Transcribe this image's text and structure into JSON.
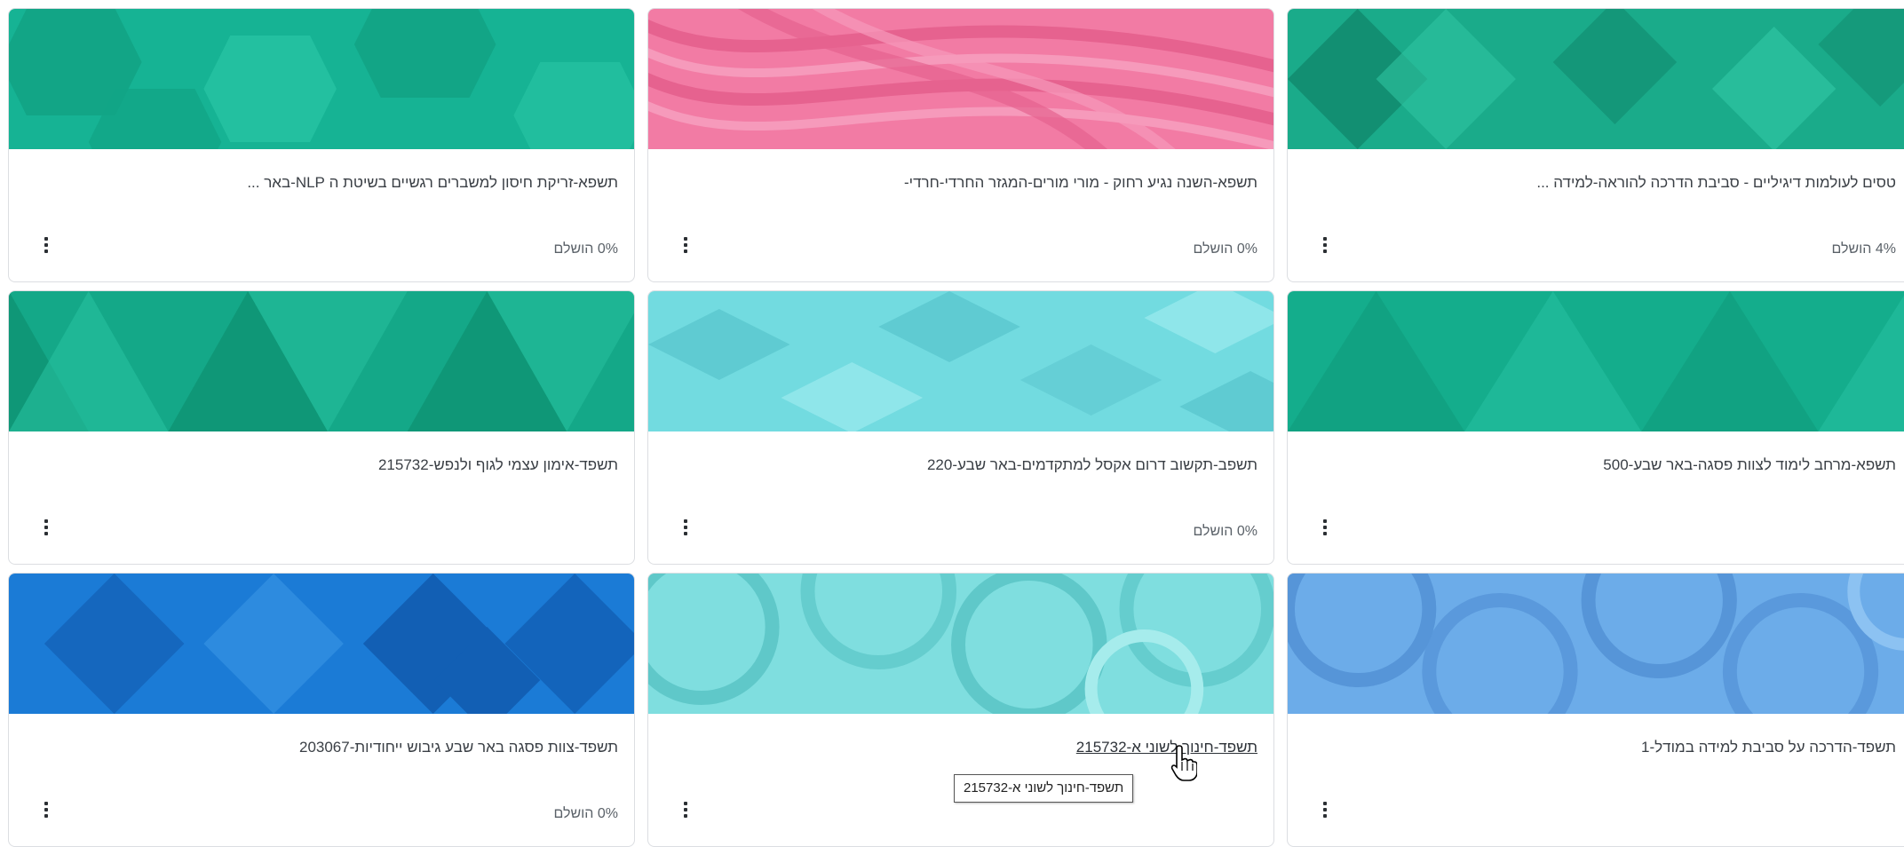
{
  "progress_suffix": "הושלם",
  "cards": [
    {
      "title": "תשפא-זריקת חיסון למשברים רגשיים בשיטת ה NLP-באר ...",
      "progress": "0% הושלם",
      "banner": "green-hexagons",
      "colors": [
        "#16b394",
        "#12a586",
        "#27c3a3"
      ]
    },
    {
      "title": "תשפא-השנה נגיע רחוק - מורי מורים-המגזר החרדי-חרדי-",
      "progress": "0% הושלם",
      "banner": "pink-waves",
      "colors": [
        "#f27ba4",
        "#e6628f",
        "#f69abb"
      ]
    },
    {
      "title": "טסים לעולמות דיגיליים - סביבת הדרכה להוראה-למידה ...",
      "progress": "4% הושלם",
      "banner": "green-diamonds",
      "colors": [
        "#1aab8a",
        "#128f72",
        "#2fc5a2"
      ]
    },
    {
      "title": "תשפד-אימון עצמי לגוף ולנפש-215732",
      "progress": "",
      "banner": "green-triangles",
      "colors": [
        "#14a888",
        "#0f9777",
        "#27c1a0"
      ]
    },
    {
      "title": "תשפב-תקשוב דרום אקסל למתקדמים-באר שבע-220",
      "progress": "0% הושלם",
      "banner": "cyan-diamonds",
      "colors": [
        "#72dbe0",
        "#5fcbd2",
        "#8fe6ea"
      ]
    },
    {
      "title": "תשפא-מרחב לימוד לצוות פסגה-באר שבע-500",
      "progress": "",
      "banner": "green-triangles-2",
      "colors": [
        "#14ad8c",
        "#0f9b7b",
        "#28c4a3"
      ]
    },
    {
      "title": "תשפד-צוות פסגה באר שבע גיבוש ייחודיות-203067",
      "progress": "0% הושלם",
      "banner": "blue-diamonds",
      "colors": [
        "#1b7bd6",
        "#125fb4",
        "#3a96e4"
      ]
    },
    {
      "title": "תשפד-חינוך לשוני א-215732",
      "progress": "",
      "banner": "cyan-circles",
      "colors": [
        "#7fdedf",
        "#5fc8c9",
        "#a6ecec"
      ]
    },
    {
      "title": "תשפד-הדרכה על סביבת למידה במודל-1",
      "progress": "",
      "banner": "lightblue-circles",
      "colors": [
        "#6cace9",
        "#5695d8",
        "#8cc2f2"
      ]
    }
  ],
  "tooltip": {
    "text": "תשפד-חינוך לשוני א-215732"
  }
}
